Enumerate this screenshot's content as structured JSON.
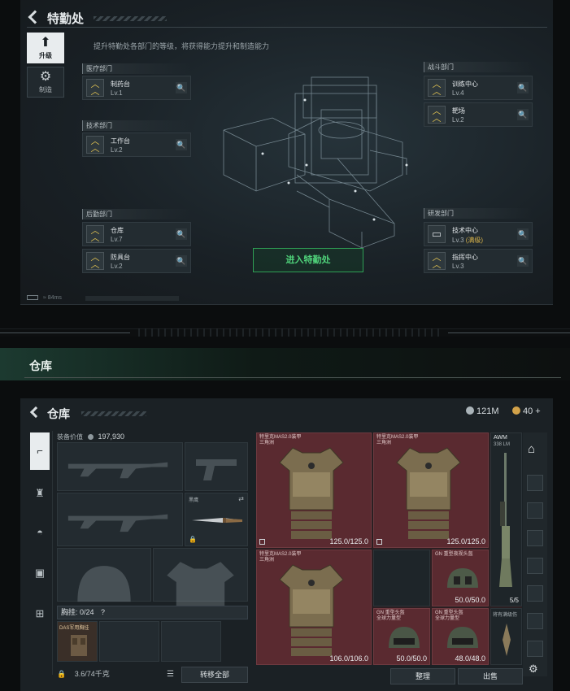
{
  "top": {
    "title": "特勤处",
    "subtitle": "提升特勤处各部门的等级，将获得能力提升和制造能力",
    "tabs": [
      {
        "label": "升级",
        "icon": "upgrade-icon"
      },
      {
        "label": "制造",
        "icon": "craft-icon"
      }
    ],
    "departments": {
      "medical": {
        "title": "医疗部门",
        "items": [
          {
            "name": "制药台",
            "level": "Lv.1"
          }
        ]
      },
      "tech": {
        "title": "技术部门",
        "items": [
          {
            "name": "工作台",
            "level": "Lv.2"
          }
        ]
      },
      "logistics": {
        "title": "后勤部门",
        "items": [
          {
            "name": "仓库",
            "level": "Lv.7"
          },
          {
            "name": "防具台",
            "level": "Lv.2"
          }
        ]
      },
      "combat": {
        "title": "战斗部门",
        "items": [
          {
            "name": "训练中心",
            "level": "Lv.4"
          },
          {
            "name": "靶场",
            "level": "Lv.2"
          }
        ]
      },
      "research": {
        "title": "研发部门",
        "items": [
          {
            "name": "技术中心",
            "level": "Lv.3",
            "badge": "(满级)"
          },
          {
            "name": "指挥中心",
            "level": "Lv.3"
          }
        ]
      }
    },
    "enter_button": "进入特勤处",
    "ping": "84ms"
  },
  "section_header": "仓库",
  "warehouse": {
    "title": "仓库",
    "currency_a": "121M",
    "currency_b": "40",
    "plus": "+",
    "equip_value_label": "装备价值",
    "equip_value": "197,930",
    "knife_name": "黑鹰",
    "chest_label": "胸挂: 0/24",
    "question": "?",
    "pack_item": "DAS军用胸挂",
    "weight": "3.6/74千克",
    "transfer_all": "转移全部",
    "sort": "整理",
    "sell": "出售",
    "grid": [
      {
        "name": "特里克MAS2.0装甲\n三角洲",
        "durability": "125.0/125.0"
      },
      {
        "name": "特里克MAS2.0装甲\n三角洲",
        "durability": "125.0/125.0"
      },
      {
        "name": "特里克MAS2.0装甲\n三角洲",
        "durability": "106.0/106.0"
      },
      {
        "name": "GN 重型夜视头盔",
        "durability": "50.0/50.0"
      },
      {
        "name": "GN 重型头盔\n全球力量型",
        "durability": "50.0/50.0"
      },
      {
        "name": "GN 重型头盔\n全球力量型",
        "durability": "48.0/48.0"
      }
    ],
    "awm": {
      "name": "AWM",
      "ammo": "338 LM",
      "count": "5/5"
    },
    "side_item": "将有满级伤"
  },
  "colors": {
    "accent_green": "#4fd27a",
    "accent_gold": "#e3c452",
    "grid_red": "#5a2a30"
  }
}
